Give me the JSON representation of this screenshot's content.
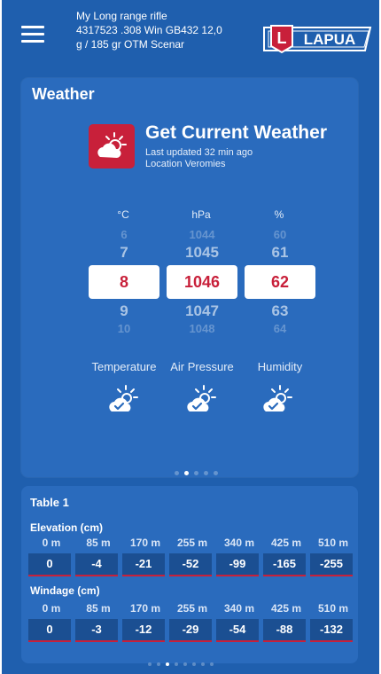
{
  "header": {
    "title_lines": [
      "My Long range rifle",
      "4317523 .308 Win GB432 12,0",
      "g / 185 gr  OTM Scenar"
    ],
    "logo_text": "LAPUA",
    "logo_letter": "L"
  },
  "weather": {
    "card_title": "Weather",
    "get_weather_title": "Get Current Weather",
    "last_updated": "Last updated 32 min ago",
    "location": "Location Veromies",
    "units": [
      "°C",
      "hPa",
      "%"
    ],
    "temperature": {
      "far_above": "6",
      "above": "7",
      "selected": "8",
      "below": "9",
      "far_below": "10"
    },
    "pressure": {
      "far_above": "1044",
      "above": "1045",
      "selected": "1046",
      "below": "1047",
      "far_below": "1048"
    },
    "humidity": {
      "far_above": "60",
      "above": "61",
      "selected": "62",
      "below": "63",
      "far_below": "64"
    },
    "labels": [
      "Temperature",
      "Air Pressure",
      "Humidity"
    ],
    "pager": {
      "count": 5,
      "active_index": 1
    }
  },
  "table": {
    "title": "Table 1",
    "elevation_title": "Elevation (cm)",
    "windage_title": "Windage (cm)",
    "distances": [
      "0 m",
      "85 m",
      "170 m",
      "255 m",
      "340 m",
      "425 m",
      "510 m"
    ],
    "elevation_values": [
      "0",
      "-4",
      "-21",
      "-52",
      "-99",
      "-165",
      "-255"
    ],
    "windage_values": [
      "0",
      "-3",
      "-12",
      "-29",
      "-54",
      "-88",
      "-132"
    ],
    "pager": {
      "count": 8,
      "active_index": 2
    }
  },
  "colors": {
    "background": "#1f5fae",
    "card": "#2a6bbd",
    "accent_red": "#c8203a",
    "cell_bg": "#1b4f92"
  }
}
